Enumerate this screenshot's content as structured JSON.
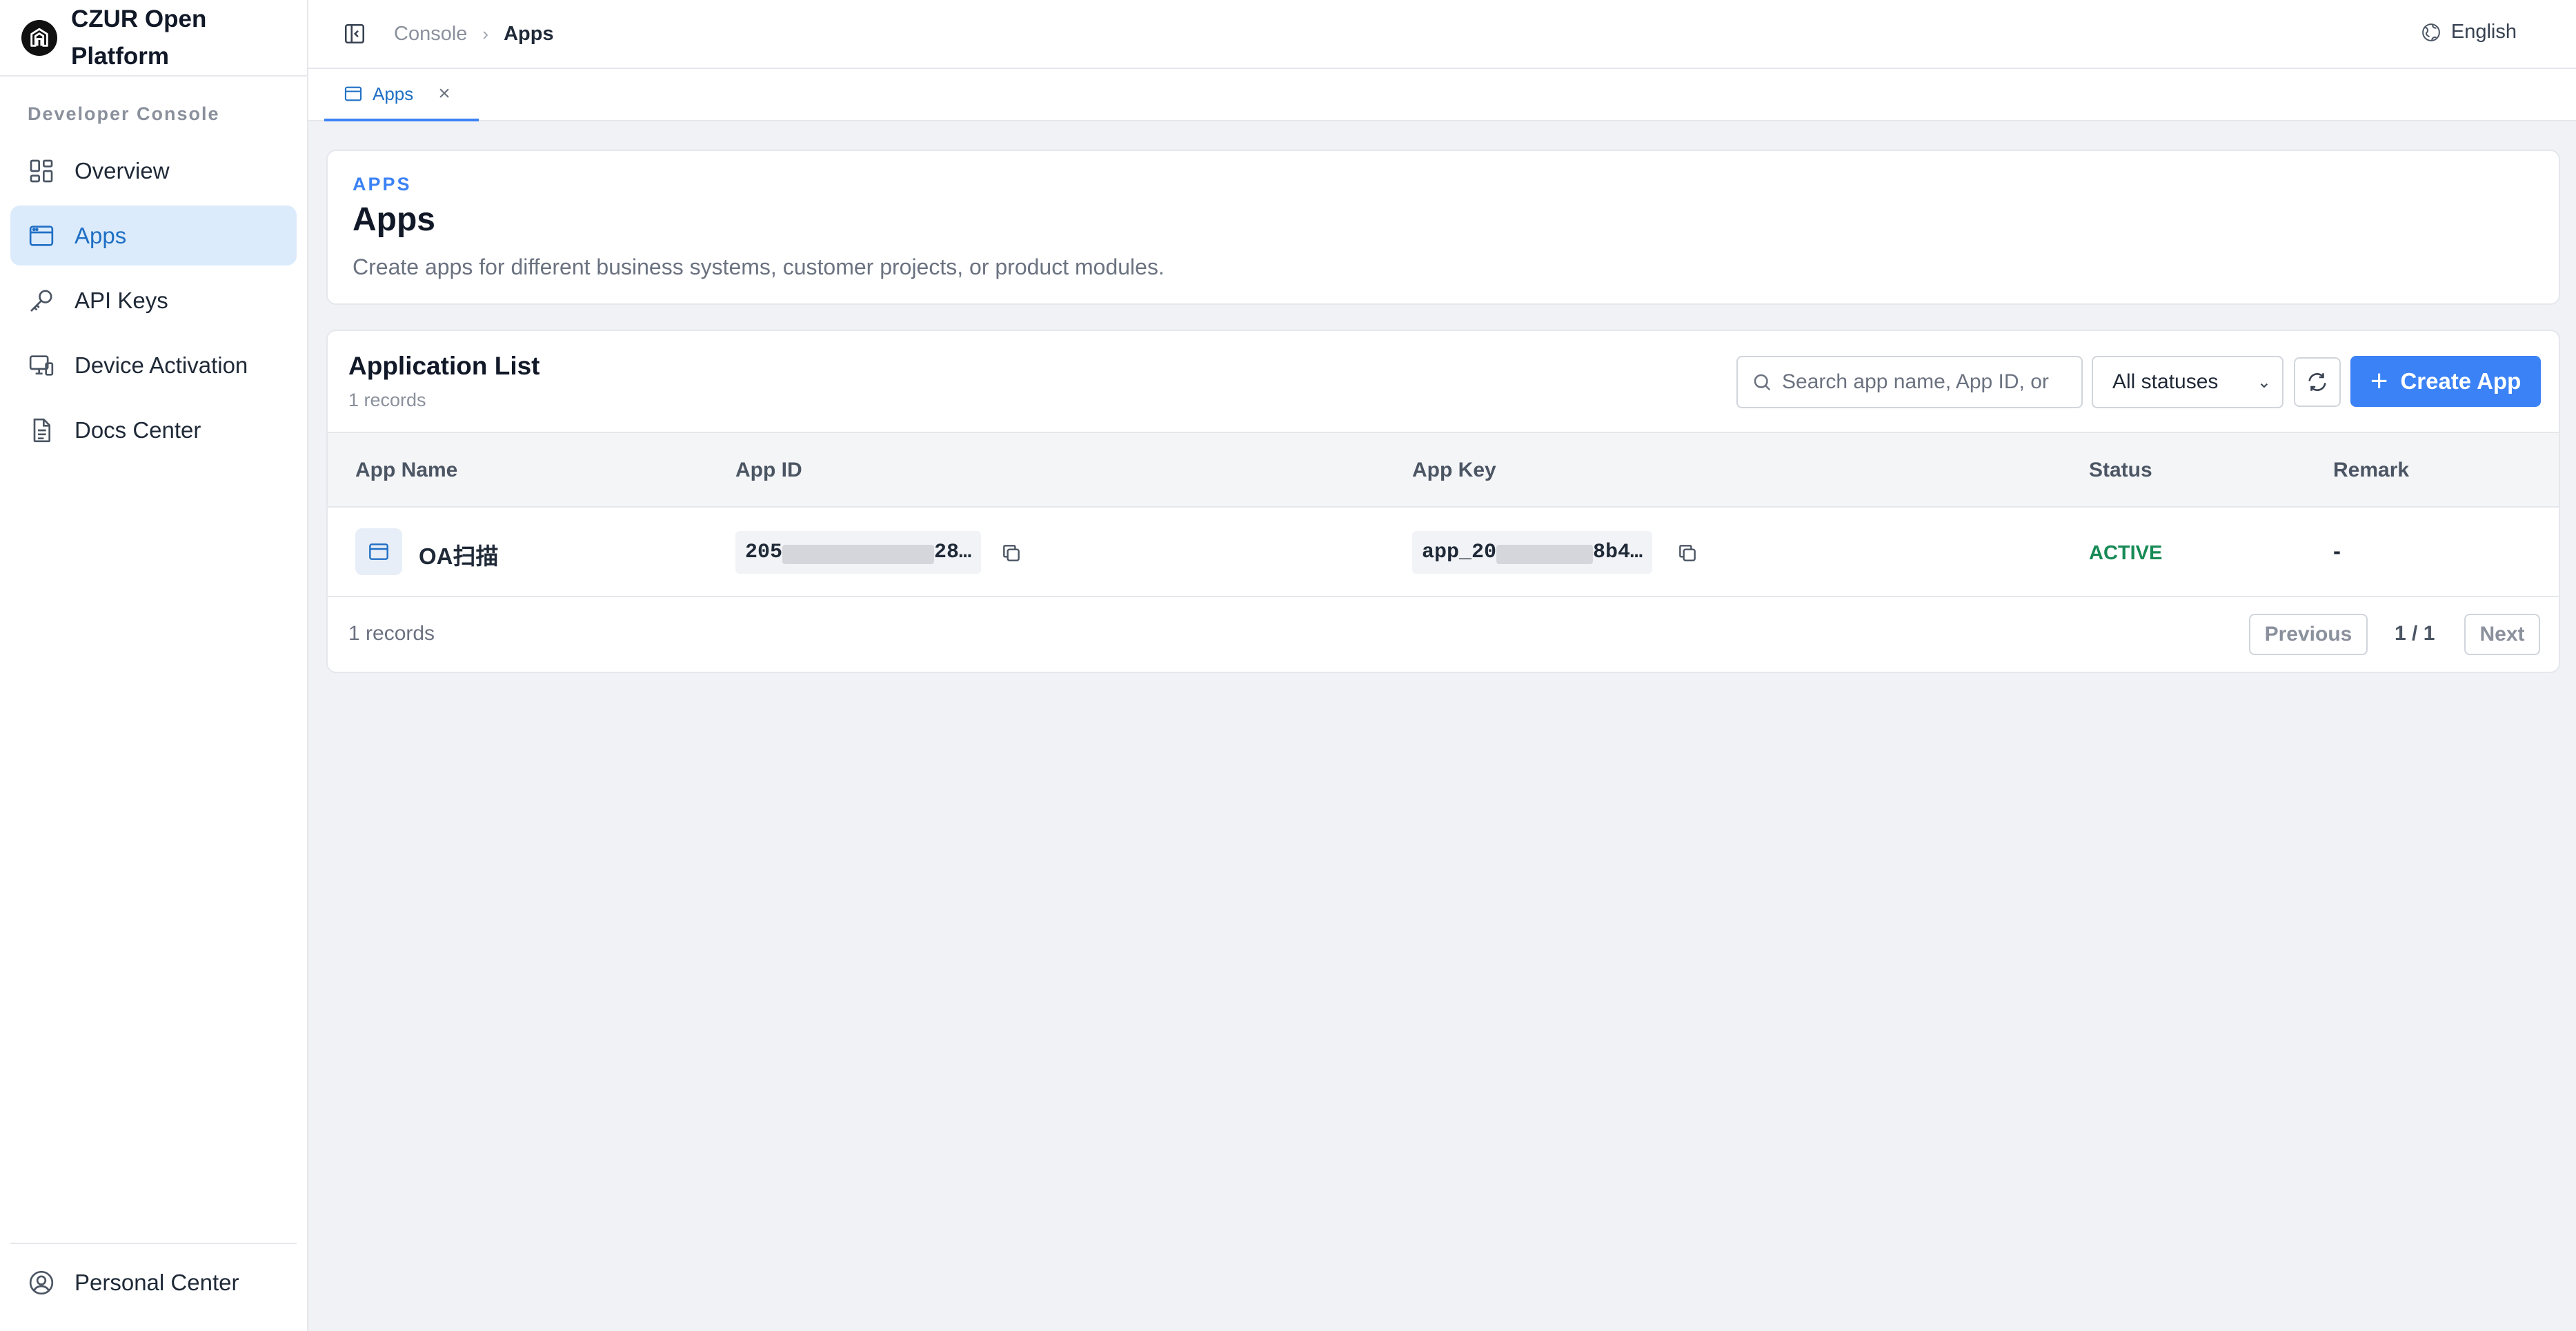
{
  "brand": {
    "name": "CZUR Open Platform",
    "logo_icon": "czur-logo-icon"
  },
  "sidebar": {
    "section_label": "Developer Console",
    "items": [
      {
        "label": "Overview",
        "icon": "grid-icon",
        "active": false
      },
      {
        "label": "Apps",
        "icon": "app-window-icon",
        "active": true
      },
      {
        "label": "API Keys",
        "icon": "key-icon",
        "active": false
      },
      {
        "label": "Device Activation",
        "icon": "device-icon",
        "active": false
      },
      {
        "label": "Docs Center",
        "icon": "document-icon",
        "active": false
      }
    ],
    "bottom_item": {
      "label": "Personal Center",
      "icon": "user-circle-icon"
    }
  },
  "topbar": {
    "breadcrumb": [
      "Console",
      "Apps"
    ],
    "language": "English"
  },
  "tabs": [
    {
      "label": "Apps",
      "active": true
    }
  ],
  "header": {
    "eyebrow": "APPS",
    "title": "Apps",
    "description": "Create apps for different business systems, customer projects, or product modules."
  },
  "list": {
    "title": "Application List",
    "count": "1 records",
    "search_placeholder": "Search app name, App ID, or",
    "status_filter": "All statuses",
    "create_label": "Create App",
    "columns": [
      "App Name",
      "App ID",
      "App Key",
      "Status",
      "Remark"
    ],
    "rows": [
      {
        "app_name": "OA扫描",
        "app_id_prefix": "205",
        "app_id_suffix": "28…",
        "app_key_prefix": "app_20",
        "app_key_suffix": "8b4…",
        "status": "ACTIVE",
        "remark": "-"
      }
    ],
    "footer_count": "1 records",
    "pager": {
      "previous": "Previous",
      "page": "1 / 1",
      "next": "Next"
    }
  },
  "colors": {
    "accent": "#3b82f6",
    "active_status": "#178a55",
    "active_nav_bg": "#dcebfb"
  }
}
